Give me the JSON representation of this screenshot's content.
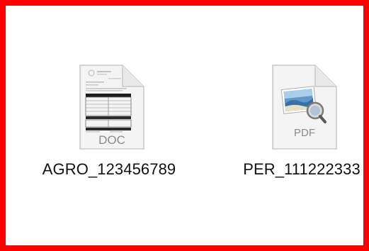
{
  "files": [
    {
      "name": "AGRO_123456789",
      "type_label": "DOC",
      "icon": "word-document-icon"
    },
    {
      "name": "PER_111222333",
      "type_label": "PDF",
      "icon": "pdf-preview-icon"
    }
  ],
  "colors": {
    "frame_border": "#ff0000",
    "background": "#ffffff",
    "label_text": "#111111"
  }
}
